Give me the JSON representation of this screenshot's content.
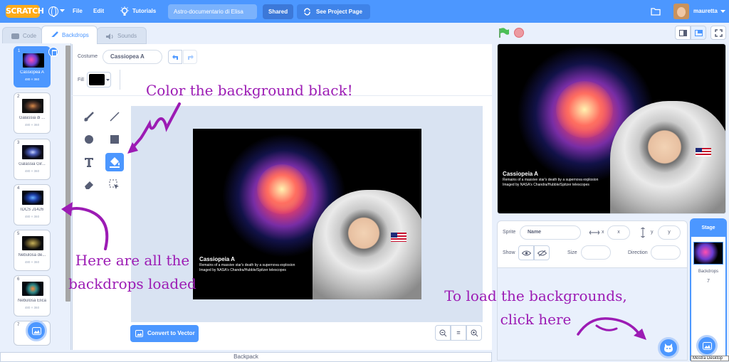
{
  "menubar": {
    "logo_text": "SCRATCH",
    "file": "File",
    "edit": "Edit",
    "tutorials": "Tutorials",
    "project_title": "Astro-documentario di Elisa",
    "shared": "Shared",
    "see_project": "See Project Page",
    "username": "mauretta",
    "accent": "#4c97ff"
  },
  "tabs": {
    "code": "Code",
    "backdrops": "Backdrops",
    "sounds": "Sounds"
  },
  "backdrops": [
    {
      "num": "1",
      "name": "Cassiopea A",
      "size": "480 × 360"
    },
    {
      "num": "2",
      "name": "Galassia di ...",
      "size": "480 × 360"
    },
    {
      "num": "3",
      "name": "Galassia Gir...",
      "size": "480 × 360"
    },
    {
      "num": "4",
      "name": "IDCS J1426",
      "size": "480 × 360"
    },
    {
      "num": "5",
      "name": "Nebulosa de...",
      "size": "480 × 360"
    },
    {
      "num": "6",
      "name": "Nebulosa Elica",
      "size": "480 × 360"
    },
    {
      "num": "7",
      "name": "",
      "size": ""
    }
  ],
  "editor": {
    "costume_label": "Costume",
    "costume_name": "Cassiopea A",
    "fill_label": "Fill",
    "fill_color": "#000000",
    "convert_button": "Convert to Vector",
    "zoom_reset": "="
  },
  "artwork": {
    "title": "Cassiopeia A",
    "line1": "Remains of a massive star's death by a supernova explosion",
    "line2": "Imaged by NASA's Chandra/Hubble/Spitzer telescopes"
  },
  "sprite_info": {
    "sprite_label": "Sprite",
    "name_placeholder": "Name",
    "x_label": "x",
    "x_value": "x",
    "y_label": "y",
    "y_value": "y",
    "show_label": "Show",
    "size_label": "Size",
    "direction_label": "Direction"
  },
  "stage_panel": {
    "title": "Stage",
    "backdrops_label": "Backdrops",
    "backdrops_count": "7",
    "tooltip": "Mostra Desktop"
  },
  "annotations": {
    "color_black": "Color the background black!",
    "here_backdrops": "Here are all the backdrops loaded",
    "load_bg": "To load the backgrounds, click here"
  },
  "backpack": "Backpack"
}
